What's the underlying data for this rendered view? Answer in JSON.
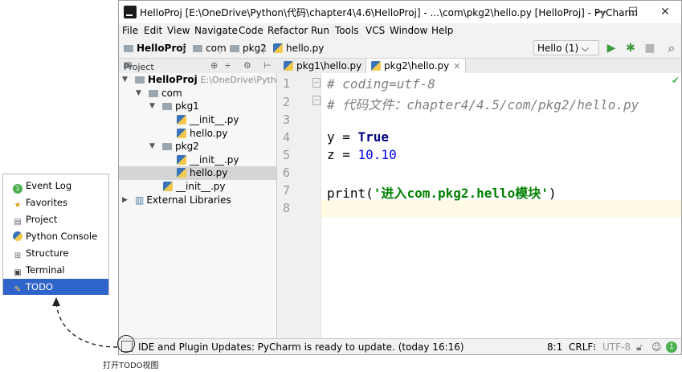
{
  "window": {
    "title": "HelloProj [E:\\OneDrive\\Python\\代码\\chapter4\\4.6\\HelloProj] - ...\\com\\pkg2\\hello.py [HelloProj] - PyCharm",
    "controls": {
      "minimize": "—",
      "maximize": "☐",
      "close": "✕"
    }
  },
  "menu": [
    "File",
    "Edit",
    "View",
    "Navigate",
    "Code",
    "Refactor",
    "Run",
    "Tools",
    "VCS",
    "Window",
    "Help"
  ],
  "breadcrumb": [
    "HelloProj",
    "com",
    "pkg2",
    "hello.py"
  ],
  "toolbar": {
    "run_config": "Hello (1) ⌵",
    "run_icon": "▶",
    "debug_icon": "✱",
    "stop_icon": "■",
    "search_icon": "⌕"
  },
  "project_panel": {
    "header": "Project",
    "tree": [
      {
        "label": "HelloProj",
        "path": "E:\\OneDrive\\Python\\"
      },
      {
        "label": "com"
      },
      {
        "label": "pkg1"
      },
      {
        "label": "__init__.py"
      },
      {
        "label": "hello.py"
      },
      {
        "label": "pkg2"
      },
      {
        "label": "__init__.py"
      },
      {
        "label": "hello.py"
      },
      {
        "label": "__init__.py"
      },
      {
        "label": "External Libraries"
      }
    ]
  },
  "editor": {
    "tabs": [
      {
        "label": "pkg1\\hello.py"
      },
      {
        "label": "pkg2\\hello.py"
      }
    ],
    "line_numbers": [
      "1",
      "2",
      "3",
      "4",
      "5",
      "6",
      "7",
      "8"
    ],
    "code": {
      "l1": "# coding=utf-8",
      "l2": "# 代码文件：chapter4/4.5/com/pkg2/hello.py",
      "l4_var": "y = ",
      "l4_kw": "True",
      "l5_var": "z = ",
      "l5_num": "10.10",
      "l7_fn": "print(",
      "l7_str_a": "'进入",
      "l7_str_b": "com.pkg2.hello",
      "l7_str_c": "模块'",
      "l7_close": ")"
    },
    "check_icon": "✔"
  },
  "status": {
    "message": "IDE and Plugin Updates: PyCharm is ready to update. (today 16:16)",
    "position": "8:1",
    "line_sep": "CRLF⁝",
    "encoding": "UTF-8",
    "badge": "1"
  },
  "popup": {
    "items": [
      "Event Log",
      "Favorites",
      "Project",
      "Python Console",
      "Structure",
      "Terminal",
      "TODO"
    ],
    "selected": "TODO"
  },
  "caption": "打开TODO视图"
}
